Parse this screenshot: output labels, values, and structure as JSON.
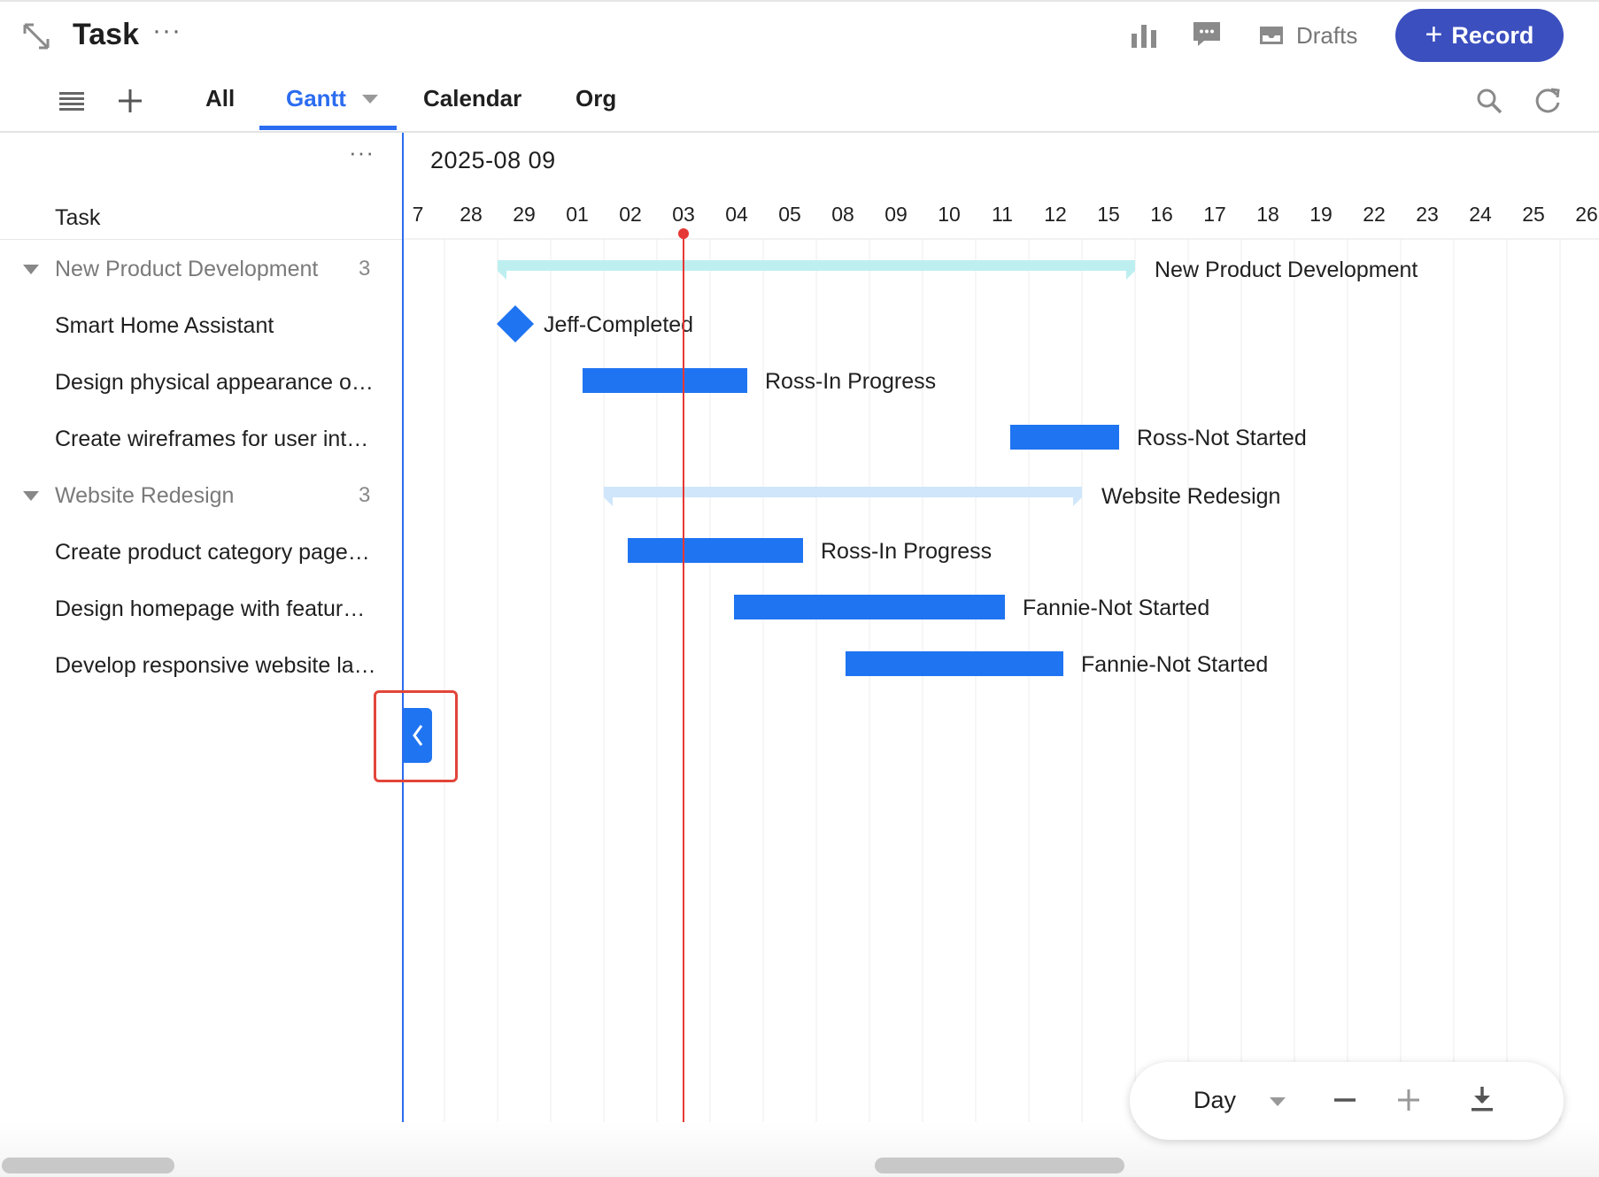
{
  "header": {
    "title": "Task",
    "more_label": "···",
    "drafts_label": "Drafts",
    "record_label": "Record",
    "record_plus": "+",
    "icons": [
      "expand-icon",
      "chart-icon",
      "comment-icon",
      "drafts-icon",
      "plus-icon"
    ]
  },
  "tabs": {
    "all": "All",
    "gantt": "Gantt",
    "calendar": "Calendar",
    "org": "Org",
    "active": "Gantt"
  },
  "left_panel": {
    "more_label": "···",
    "column_header": "Task",
    "rows": [
      {
        "type": "group",
        "label": "New Product Development",
        "count": "3"
      },
      {
        "type": "task",
        "label": "Smart Home Assistant"
      },
      {
        "type": "task",
        "label": "Design physical appearance o…"
      },
      {
        "type": "task",
        "label": "Create wireframes for user int…"
      },
      {
        "type": "group",
        "label": "Website Redesign",
        "count": "3"
      },
      {
        "type": "task",
        "label": "Create product category page…"
      },
      {
        "type": "task",
        "label": "Design homepage with featur…"
      },
      {
        "type": "task",
        "label": "Develop responsive website la…"
      }
    ]
  },
  "chart_data": {
    "type": "gantt",
    "month_label": "2025-08 09",
    "day_ticks": [
      "7",
      "28",
      "29",
      "01",
      "02",
      "03",
      "04",
      "05",
      "08",
      "09",
      "10",
      "11",
      "12",
      "15",
      "16",
      "17",
      "18",
      "19",
      "22",
      "23",
      "24",
      "25",
      "26"
    ],
    "today": "03",
    "bars": [
      {
        "kind": "group",
        "label": "New Product Development",
        "start": 2,
        "end": 14,
        "color": "#bdeff0"
      },
      {
        "kind": "milestone",
        "label": "Jeff-Completed",
        "start": 2.1,
        "color": "#1f74f1"
      },
      {
        "kind": "task",
        "label": "Ross-In Progress",
        "start": 3.6,
        "end": 6.7,
        "color": "#1f74f1"
      },
      {
        "kind": "task",
        "label": "Ross-Not Started",
        "start": 11.65,
        "end": 13.7,
        "color": "#1f74f1"
      },
      {
        "kind": "group",
        "label": "Website Redesign",
        "start": 4.0,
        "end": 13.0,
        "color": "#cfe6fb"
      },
      {
        "kind": "task",
        "label": "Ross-In Progress",
        "start": 4.45,
        "end": 7.75,
        "color": "#1f74f1"
      },
      {
        "kind": "task",
        "label": "Fannie-Not Started",
        "start": 6.45,
        "end": 11.55,
        "color": "#1f74f1"
      },
      {
        "kind": "task",
        "label": "Fannie-Not Started",
        "start": 8.55,
        "end": 12.65,
        "color": "#1f74f1"
      }
    ]
  },
  "zoom": {
    "scale": "Day",
    "icons": [
      "minus-icon",
      "plus-icon",
      "download-icon"
    ]
  },
  "colors": {
    "accent": "#2b6cf0",
    "record_button": "#3c4fbf",
    "today_line": "#e53935",
    "task_bar": "#1f74f1"
  }
}
